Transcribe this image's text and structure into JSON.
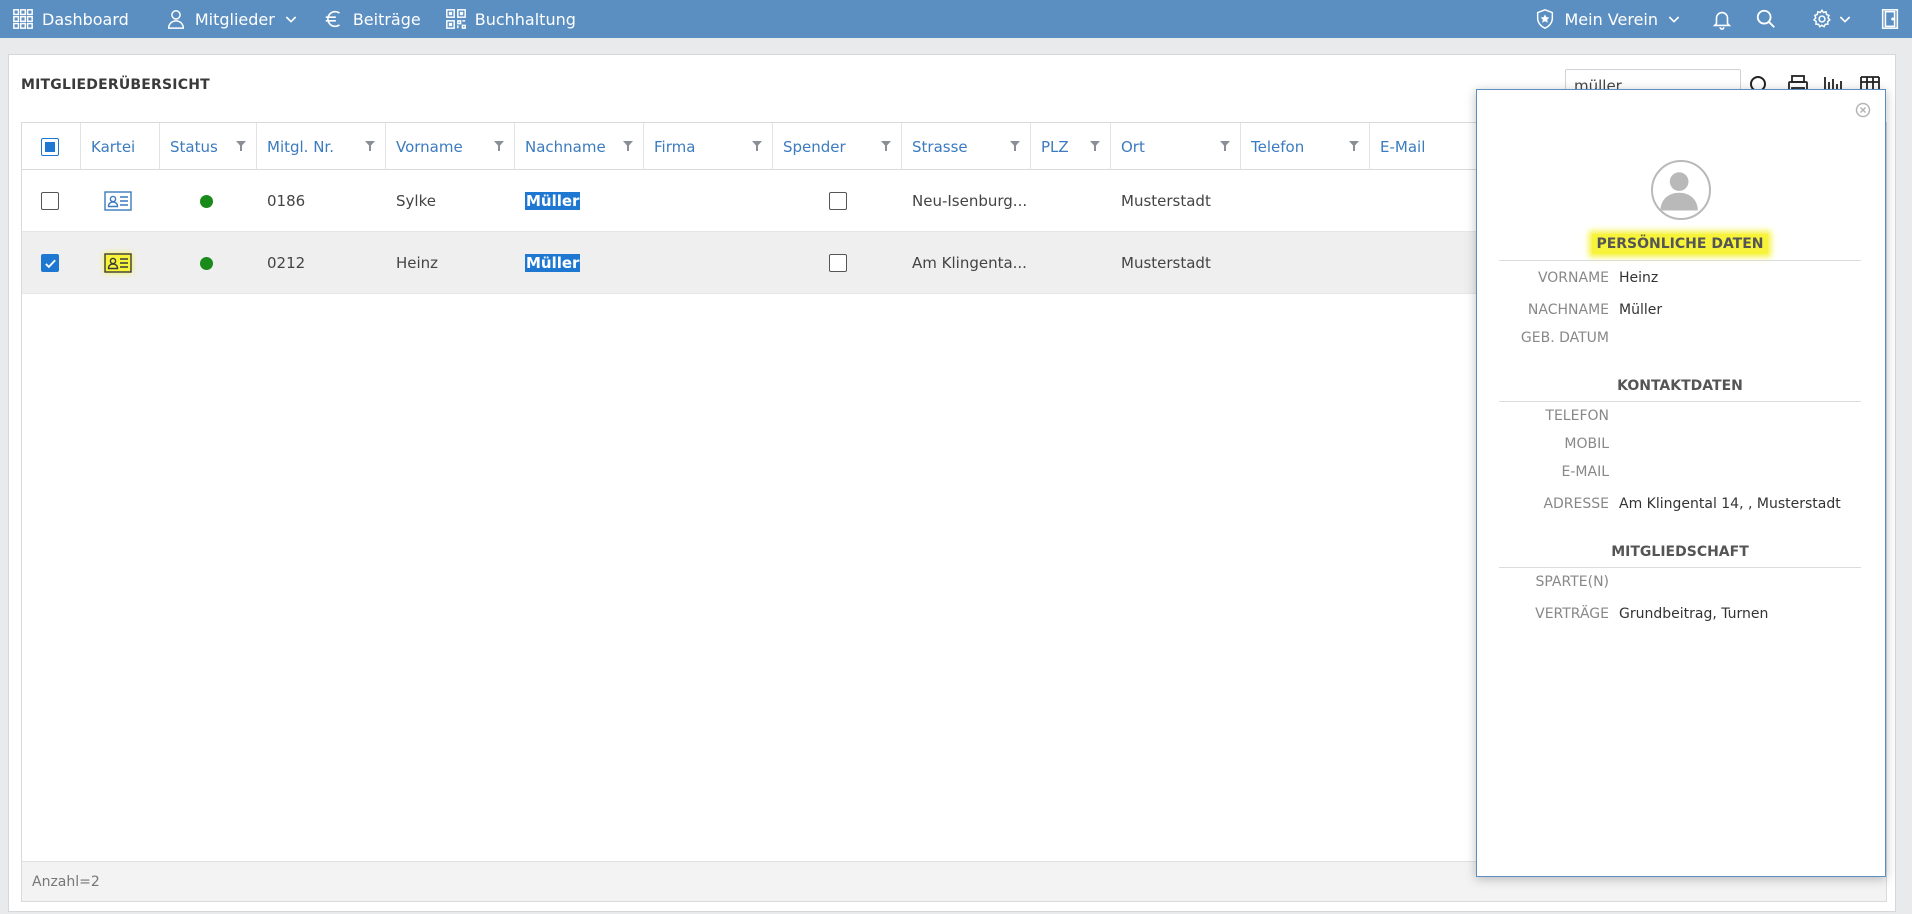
{
  "nav": {
    "dashboard": "Dashboard",
    "mitglieder": "Mitglieder",
    "beitraege": "Beiträge",
    "buchhaltung": "Buchhaltung",
    "verein": "Mein Verein"
  },
  "page": {
    "title": "MITGLIEDERÜBERSICHT",
    "search_value": "müller"
  },
  "columns": {
    "kartei": "Kartei",
    "status": "Status",
    "nr": "Mitgl. Nr.",
    "vorname": "Vorname",
    "nachname": "Nachname",
    "firma": "Firma",
    "spender": "Spender",
    "strasse": "Strasse",
    "plz": "PLZ",
    "ort": "Ort",
    "telefon": "Telefon",
    "email": "E-Mail"
  },
  "rows": [
    {
      "nr": "0186",
      "vorname": "Sylke",
      "nachname": "Müller",
      "strasse": "Neu-Isenburg...",
      "ort": "Musterstadt",
      "checked": false
    },
    {
      "nr": "0212",
      "vorname": "Heinz",
      "nachname": "Müller",
      "strasse": "Am Klingenta...",
      "ort": "Musterstadt",
      "checked": true
    }
  ],
  "footer": {
    "count": "Anzahl=2"
  },
  "panel": {
    "personal_title": "PERSÖNLICHE DATEN",
    "vorname_label": "VORNAME",
    "vorname_value": "Heinz",
    "nachname_label": "NACHNAME",
    "nachname_value": "Müller",
    "geb_label": "GEB. DATUM",
    "contact_title": "KONTAKTDATEN",
    "telefon_label": "TELEFON",
    "mobil_label": "MOBIL",
    "email_label": "E-MAIL",
    "adresse_label": "ADRESSE",
    "adresse_value": "Am Klingental 14, , Musterstadt",
    "membership_title": "MITGLIEDSCHAFT",
    "sparte_label": "SPARTE(N)",
    "vertraege_label": "VERTRÄGE",
    "vertraege_value": "Grundbeitrag, Turnen"
  },
  "colors": {
    "nav": "#5b8fc2",
    "link": "#3c7bbf",
    "highlight": "#1e78d2",
    "marker": "#f6f33a",
    "status_active": "#1a8a1a"
  }
}
